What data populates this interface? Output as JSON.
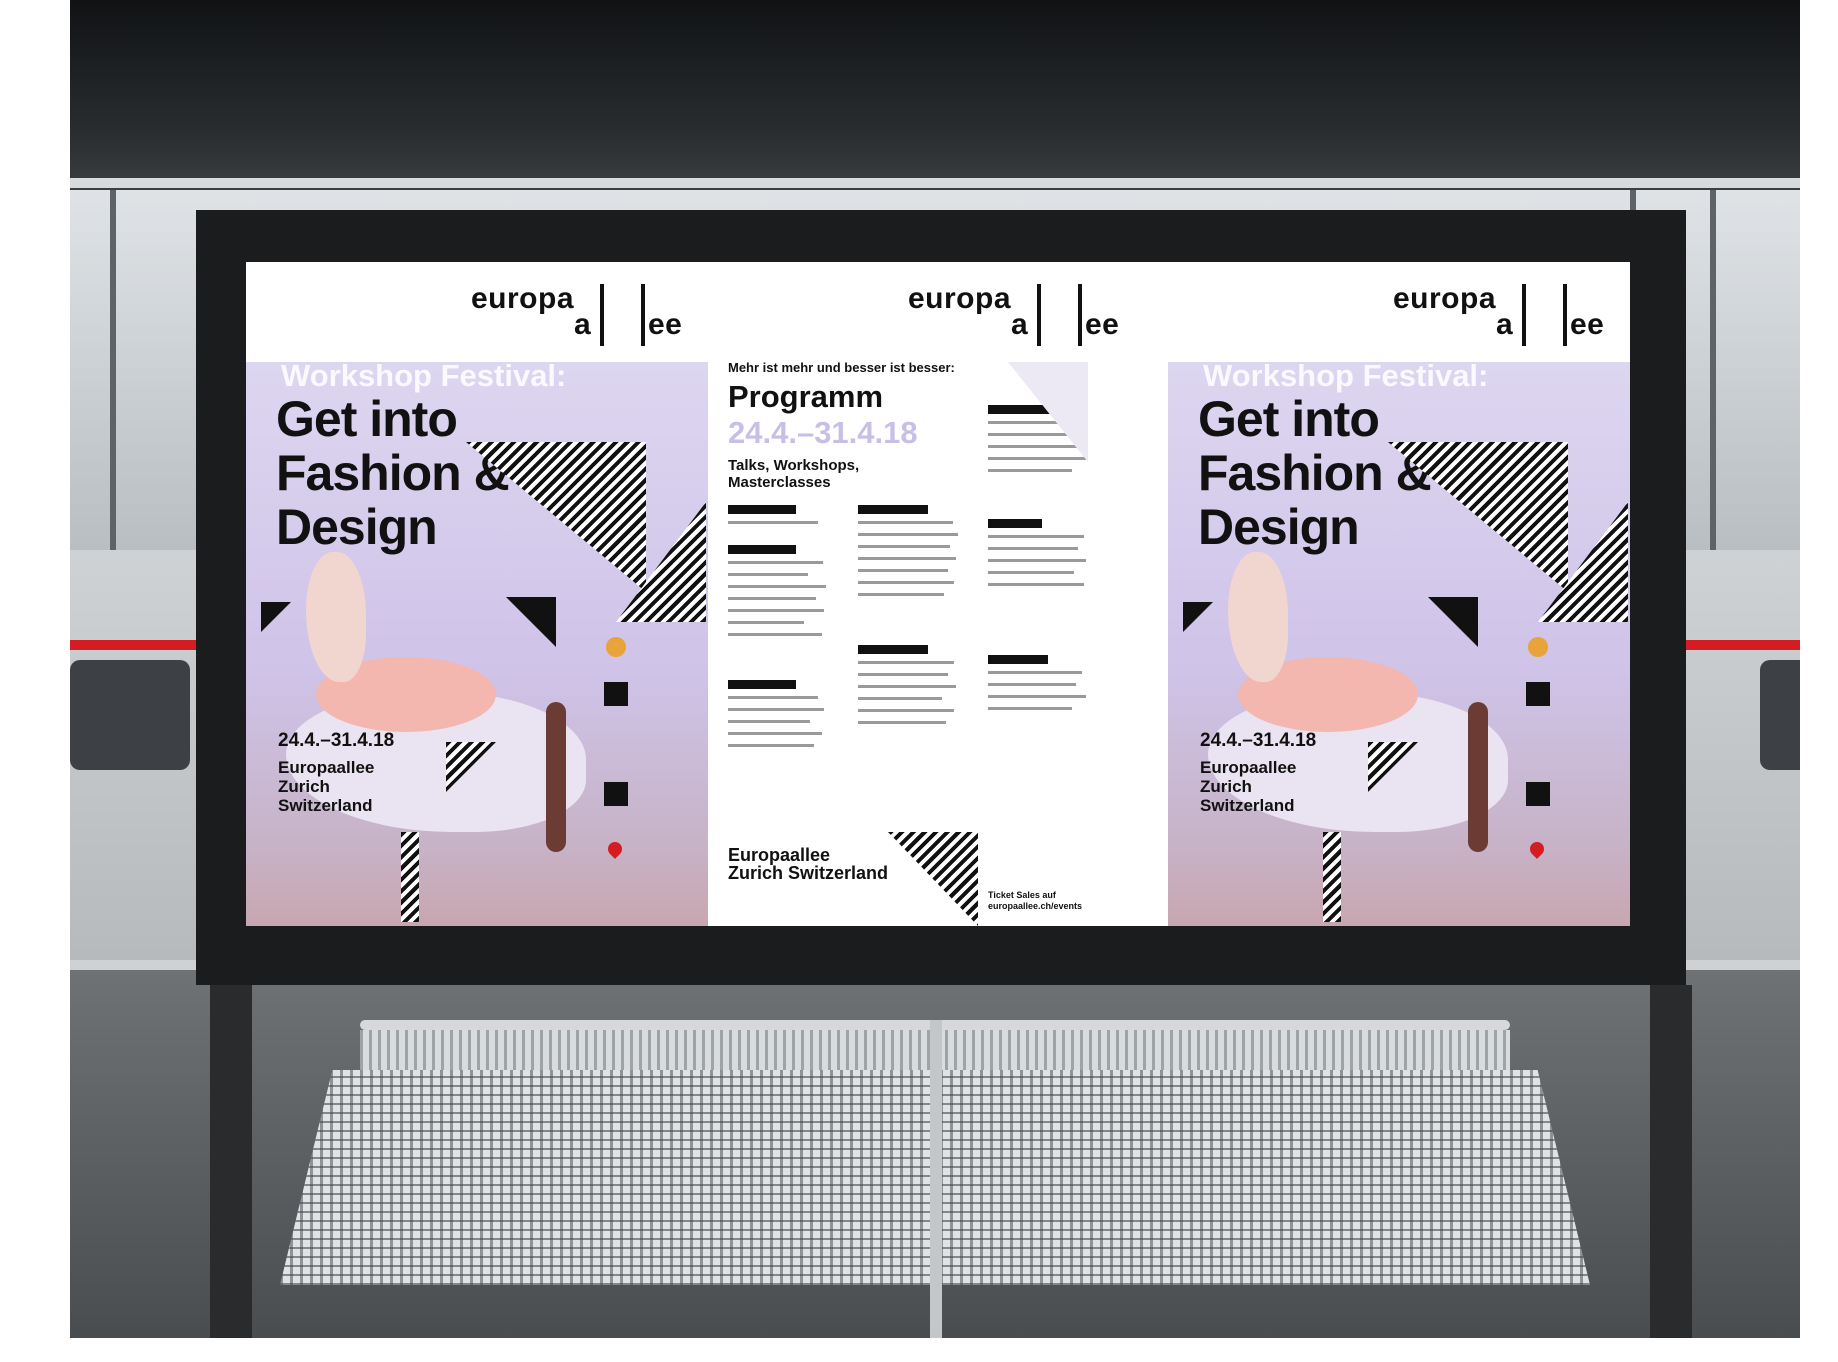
{
  "billboard": {
    "logo": {
      "part1": "europa",
      "part2": "a",
      "part3": "ee"
    },
    "left_poster": {
      "festival": "Workshop Festival:",
      "headline": [
        "Get into",
        "Fashion &",
        "Design"
      ],
      "dates": "24.4.–31.4.18",
      "place": [
        "Europaallee",
        "Zurich",
        "Switzerland"
      ]
    },
    "center_poster": {
      "intro": "Mehr ist mehr und besser ist besser:",
      "title": "Programm",
      "dates": "24.4.–31.4.18",
      "subtitle": [
        "Talks, Workshops,",
        "Masterclasses"
      ],
      "bottom_title": [
        "Europaallee",
        "Zurich Switzerland"
      ],
      "ticket": [
        "Ticket Sales auf",
        "europaallee.ch/events"
      ]
    },
    "right_poster": {
      "festival": "Workshop Festival:",
      "headline": [
        "Get into",
        "Fashion &",
        "Design"
      ],
      "dates": "24.4.–31.4.18",
      "place": [
        "Europaallee",
        "Zurich",
        "Switzerland"
      ]
    }
  },
  "colors": {
    "poster_lilac": "#cfc3e8",
    "date_lilac": "#c8bee6",
    "dress_pink": "#f3b7b0",
    "ink": "#111111",
    "train_red": "#d31d22"
  }
}
